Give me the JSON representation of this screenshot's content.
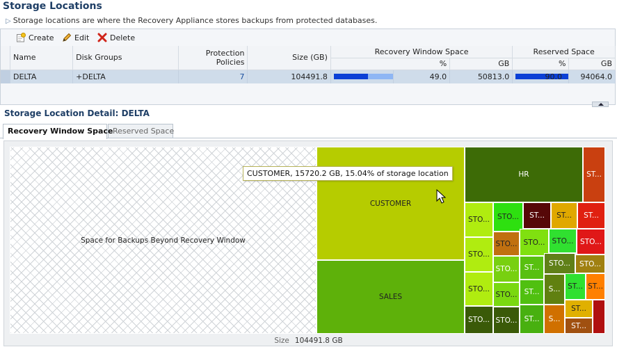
{
  "page": {
    "title": "Storage Locations",
    "description": "Storage locations are where the Recovery Appliance stores backups from protected databases."
  },
  "toolbar": {
    "create_label": "Create",
    "edit_label": "Edit",
    "delete_label": "Delete"
  },
  "table": {
    "headers": {
      "name": "Name",
      "disk_groups": "Disk Groups",
      "protection_policies_1": "Protection",
      "protection_policies_2": "Policies",
      "size": "Size (GB)",
      "recovery_window_space": "Recovery Window Space",
      "reserved_space": "Reserved Space",
      "pct": "%",
      "gb": "GB"
    },
    "rows": [
      {
        "name": "DELTA",
        "disk_groups": "+DELTA",
        "protection_policies": "7",
        "size": "104491.8",
        "rw_pct": "49.0",
        "rw_pct_value": 49,
        "rw_gb": "50813.0",
        "rs_pct": "90.0",
        "rs_pct_value": 90,
        "rs_gb": "94064.0"
      }
    ]
  },
  "detail": {
    "title": "Storage Location Detail: DELTA",
    "tabs": [
      "Recovery Window Space",
      "Reserved Space"
    ],
    "active_tab": "Recovery Window Space"
  },
  "treemap": {
    "cells": [
      {
        "label": "Space for Backups Beyond Recovery Window",
        "color": "#ffffff",
        "text": "#222222",
        "hatched": true
      },
      {
        "label": "CUSTOMER",
        "color": "#b6cc00",
        "text": "#222222"
      },
      {
        "label": "SALES",
        "color": "#5eb10a",
        "text": "#222222"
      },
      {
        "label": "HR",
        "color": "#3d6b06",
        "text": "#ffffff"
      },
      {
        "label": "ST...",
        "color": "#c94010",
        "text": "#ffffff"
      },
      {
        "label": "STO...",
        "color": "#b0ec10",
        "text": "#222222"
      },
      {
        "label": "STO...",
        "color": "#2ee010",
        "text": "#222222"
      },
      {
        "label": "ST...",
        "color": "#560808",
        "text": "#ffffff"
      },
      {
        "label": "ST...",
        "color": "#e0a800",
        "text": "#222222"
      },
      {
        "label": "ST...",
        "color": "#e02010",
        "text": "#ffffff"
      },
      {
        "label": "STO...",
        "color": "#b0ec10",
        "text": "#222222"
      },
      {
        "label": "STO...",
        "color": "#c07010",
        "text": "#222222"
      },
      {
        "label": "STO...",
        "color": "#80e010",
        "text": "#222222"
      },
      {
        "label": "STO...",
        "color": "#30e030",
        "text": "#222222"
      },
      {
        "label": "STO...",
        "color": "#e01818",
        "text": "#ffffff"
      },
      {
        "label": "STO...",
        "color": "#b0ec10",
        "text": "#222222"
      },
      {
        "label": "STO...",
        "color": "#78d010",
        "text": "#ffffff"
      },
      {
        "label": "ST...",
        "color": "#58c010",
        "text": "#ffffff"
      },
      {
        "label": "STO...",
        "color": "#608018",
        "text": "#ffffff"
      },
      {
        "label": "STO...",
        "color": "#a08010",
        "text": "#ffffff"
      },
      {
        "label": "STO...",
        "color": "#7ad810",
        "text": "#222222"
      },
      {
        "label": "ST...",
        "color": "#50c010",
        "text": "#ffffff"
      },
      {
        "label": "S...",
        "color": "#608010",
        "text": "#ffffff"
      },
      {
        "label": "ST...",
        "color": "#30e030",
        "text": "#222222"
      },
      {
        "label": "ST...",
        "color": "#ff8000",
        "text": "#222222"
      },
      {
        "label": "STO...",
        "color": "#3a5a08",
        "text": "#ffffff"
      },
      {
        "label": "STO...",
        "color": "#3a5a08",
        "text": "#ffffff"
      },
      {
        "label": "ST...",
        "color": "#48b010",
        "text": "#ffffff"
      },
      {
        "label": "S...",
        "color": "#d07000",
        "text": "#ffffff"
      },
      {
        "label": "ST...",
        "color": "#e0b000",
        "text": "#222222"
      },
      {
        "label": "ST...",
        "color": "#a05010",
        "text": "#ffffff"
      },
      {
        "label": "",
        "color": "#b01010",
        "text": "#ffffff"
      }
    ],
    "tooltip": "CUSTOMER, 15720.2 GB, 15.04% of storage location",
    "size_label": "Size",
    "size_value": "104491.8 GB"
  }
}
